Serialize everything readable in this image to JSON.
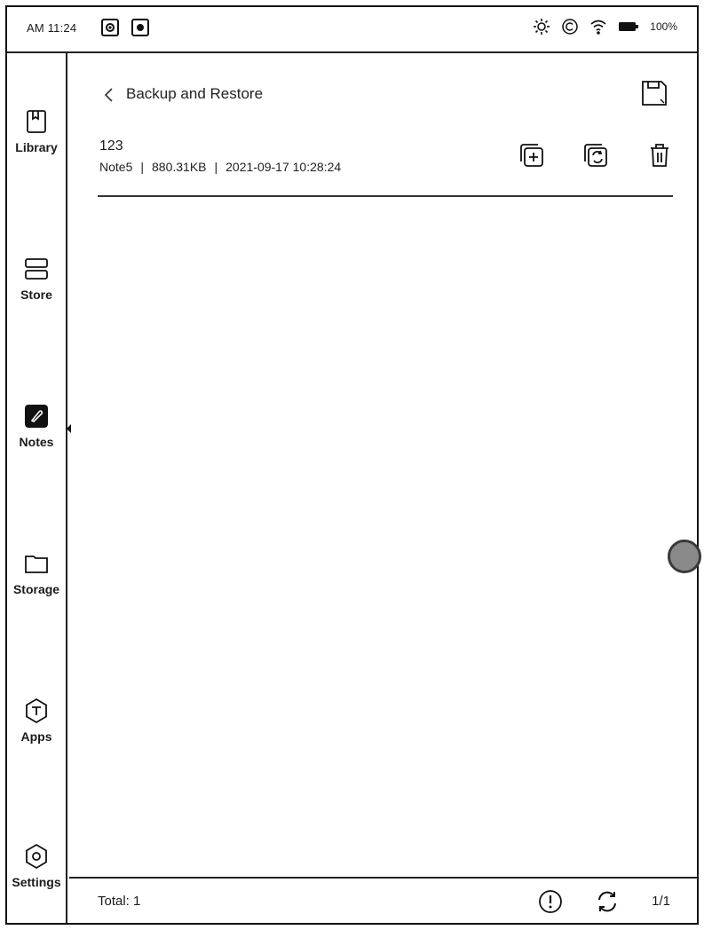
{
  "status_bar": {
    "time": "AM 11:24",
    "battery_label": "100%",
    "icons": [
      "record-icon",
      "screen-icon",
      "brightness-icon",
      "copyright-icon",
      "wifi-icon",
      "battery-icon"
    ]
  },
  "sidebar": {
    "items": [
      {
        "label": "Library",
        "icon": "book-icon"
      },
      {
        "label": "Store",
        "icon": "store-icon"
      },
      {
        "label": "Notes",
        "icon": "pen-icon",
        "active": true
      },
      {
        "label": "Storage",
        "icon": "folder-icon"
      },
      {
        "label": "Apps",
        "icon": "hexagon-icon"
      },
      {
        "label": "Settings",
        "icon": "gear-icon"
      }
    ]
  },
  "header": {
    "title": "Backup and Restore"
  },
  "backups": [
    {
      "name": "123",
      "notebook": "Note5",
      "size": "880.31KB",
      "date": "2021-09-17 10:28:24",
      "separator": "|"
    }
  ],
  "footer": {
    "total": "Total: 1",
    "page": "1/1"
  },
  "colors": {
    "ink": "#111111",
    "background": "#ffffff",
    "float_ball": "#8a8a8a"
  }
}
